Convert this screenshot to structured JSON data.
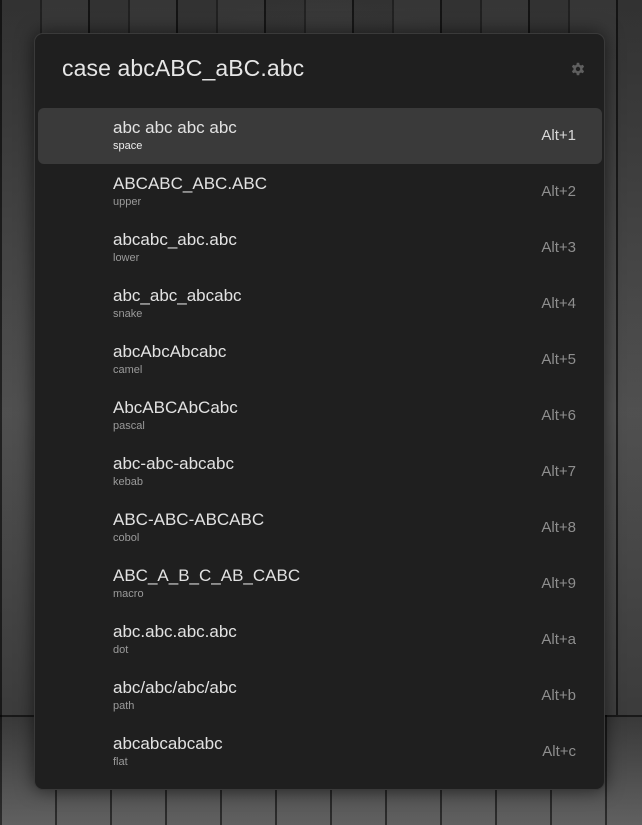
{
  "header": {
    "query": "case abcABC_aBC.abc",
    "settings_icon": "gear-icon"
  },
  "results": [
    {
      "title": "abc abc abc abc",
      "subtitle": "space",
      "shortcut": "Alt+1",
      "selected": true
    },
    {
      "title": "ABCABC_ABC.ABC",
      "subtitle": "upper",
      "shortcut": "Alt+2"
    },
    {
      "title": "abcabc_abc.abc",
      "subtitle": "lower",
      "shortcut": "Alt+3"
    },
    {
      "title": "abc_abc_abcabc",
      "subtitle": "snake",
      "shortcut": "Alt+4"
    },
    {
      "title": "abcAbcAbcabc",
      "subtitle": "camel",
      "shortcut": "Alt+5"
    },
    {
      "title": "AbcABCAbCabc",
      "subtitle": "pascal",
      "shortcut": "Alt+6"
    },
    {
      "title": "abc-abc-abcabc",
      "subtitle": "kebab",
      "shortcut": "Alt+7"
    },
    {
      "title": "ABC-ABC-ABCABC",
      "subtitle": "cobol",
      "shortcut": "Alt+8"
    },
    {
      "title": "ABC_A_B_C_AB_CABC",
      "subtitle": "macro",
      "shortcut": "Alt+9"
    },
    {
      "title": "abc.abc.abc.abc",
      "subtitle": "dot",
      "shortcut": "Alt+a"
    },
    {
      "title": "abc/abc/abc/abc",
      "subtitle": "path",
      "shortcut": "Alt+b"
    },
    {
      "title": "abcabcabcabc",
      "subtitle": "flat",
      "shortcut": "Alt+c"
    }
  ]
}
